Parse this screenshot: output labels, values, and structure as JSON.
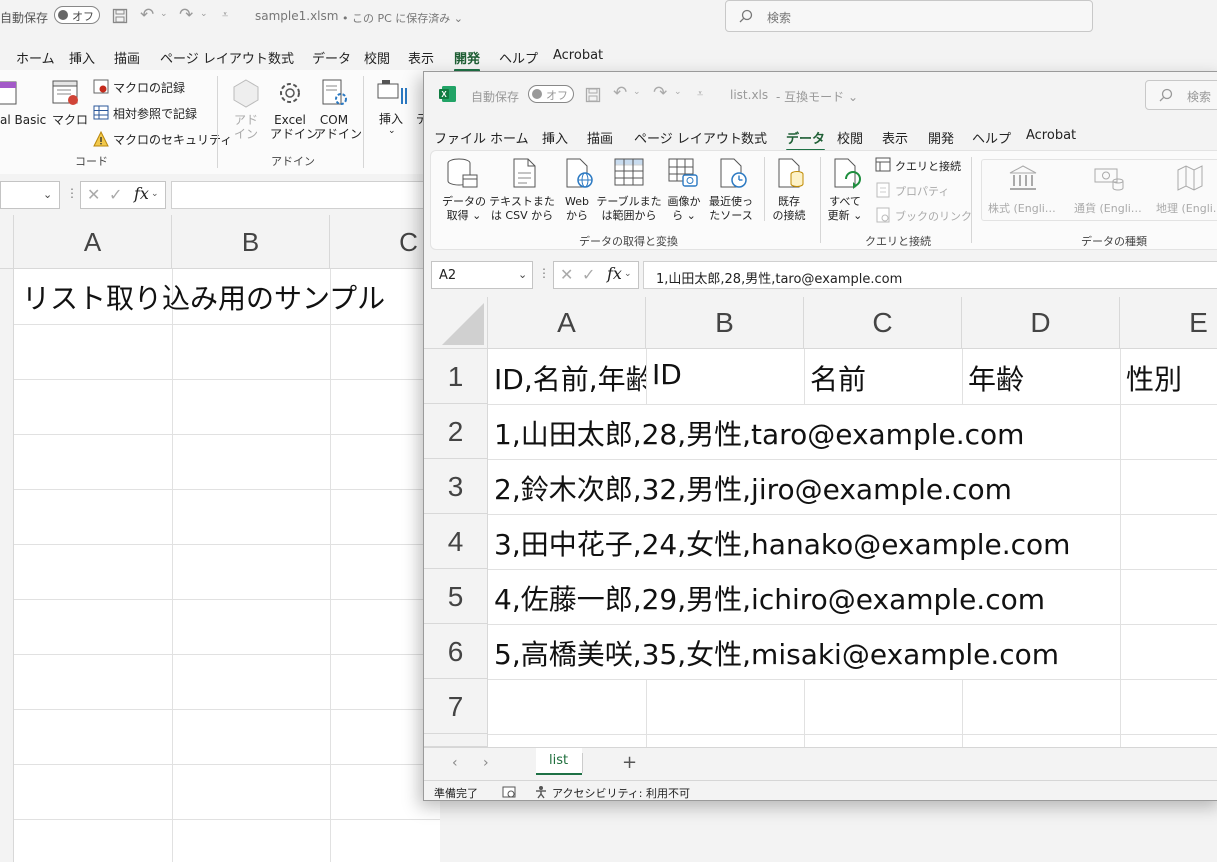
{
  "background_window": {
    "title": {
      "autosave_label": "自動保存",
      "toggle_state": "オフ",
      "filename": "sample1.xlsm",
      "save_status": "• この PC に保存済み ⌄"
    },
    "search_placeholder": "検索",
    "menu": [
      "ホーム",
      "挿入",
      "描画",
      "ページ レイアウト",
      "数式",
      "データ",
      "校閲",
      "表示",
      "開発",
      "ヘルプ",
      "Acrobat"
    ],
    "active_menu": "開発",
    "ribbon": {
      "vb_label": "al Basic",
      "macro_label": "マクロ",
      "record_macro": "マクロの記録",
      "relative_ref": "相対参照で記録",
      "macro_security": "マクロのセキュリティ",
      "code_group": "コード",
      "addin_label": "アド\nイン",
      "excel_addin": "Excel\nアドイン",
      "com_addin": "COM\nアドイン",
      "addin_group": "アドイン",
      "insert_label": "挿入",
      "design_partial": "デ"
    },
    "fx_label": "fx",
    "columns": [
      "A",
      "B",
      "C"
    ],
    "a1_text": "リスト取り込み用のサンプル"
  },
  "foreground_window": {
    "title": {
      "autosave_label": "自動保存",
      "toggle_state": "オフ",
      "filename": "list.xls",
      "mode": "-  互換モード ⌄",
      "search_placeholder": "検索"
    },
    "menu": [
      "ファイル",
      "ホーム",
      "挿入",
      "描画",
      "ページ レイアウト",
      "数式",
      "データ",
      "校閲",
      "表示",
      "開発",
      "ヘルプ",
      "Acrobat"
    ],
    "active_menu": "データ",
    "ribbon": {
      "get_data": "データの\n取得 ⌄",
      "from_text_csv": "テキストまた\nは CSV から",
      "from_web": "Web\nから",
      "from_table": "テーブルまた\nは範囲から",
      "from_picture": "画像か\nら ⌄",
      "recent_sources": "最近使っ\nたソース",
      "existing_connections": "既存\nの接続",
      "group_get_transform": "データの取得と変換",
      "refresh_all": "すべて\n更新 ⌄",
      "queries_connections": "クエリと接続",
      "properties": "プロパティ",
      "edit_links": "ブックのリンク",
      "group_queries": "クエリと接続",
      "stocks": "株式 (Engli…",
      "currencies": "通貨 (Engli…",
      "geography": "地理 (Engli…",
      "group_data_types": "データの種類"
    },
    "name_box": "A2",
    "fx_label": "fx",
    "formula": "1,山田太郎,28,男性,taro@example.com",
    "columns": [
      "A",
      "B",
      "C",
      "D",
      "E"
    ],
    "rows": [
      "1",
      "2",
      "3",
      "4",
      "5",
      "6",
      "7"
    ],
    "cells": {
      "A1": "ID,名前,年齢",
      "B1": "ID",
      "C1": "名前",
      "D1": "年齢",
      "E1": "性別",
      "A2": "1,山田太郎,28,男性,taro@example.com",
      "A3": "2,鈴木次郎,32,男性,jiro@example.com",
      "A4": "3,田中花子,24,女性,hanako@example.com",
      "A5": "4,佐藤一郎,29,男性,ichiro@example.com",
      "A6": "5,高橋美咲,35,女性,misaki@example.com"
    },
    "sheet_tab": "list",
    "add_sheet": "+",
    "status": {
      "ready": "準備完了",
      "accessibility": "アクセシビリティ: 利用不可"
    }
  },
  "colors": {
    "excel_green": "#1e7145",
    "grid_line": "#e1e1e1",
    "header_bg": "#f3f3f3"
  }
}
